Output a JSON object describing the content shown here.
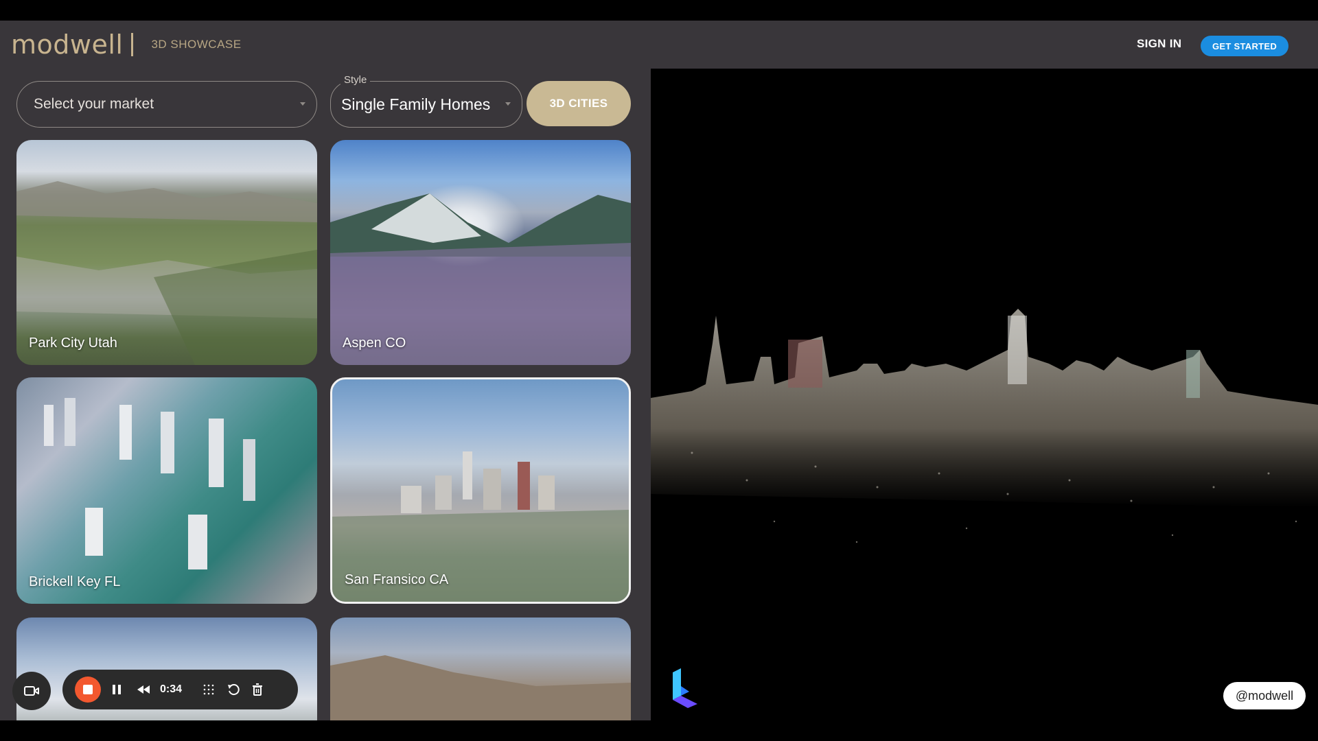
{
  "header": {
    "logo": "modwell",
    "subtitle": "3D SHOWCASE",
    "sign_in": "SIGN IN",
    "get_started": "GET STARTED"
  },
  "filters": {
    "market_placeholder": "Select your market",
    "style_label": "Style",
    "style_value": "Single Family Homes",
    "cities_button": "3D CITIES"
  },
  "cards": [
    {
      "label": "Park City Utah"
    },
    {
      "label": "Aspen CO"
    },
    {
      "label": "Brickell Key FL"
    },
    {
      "label": "San Fransico CA"
    },
    {
      "label": ""
    },
    {
      "label": ""
    }
  ],
  "recorder": {
    "timer": "0:34"
  },
  "watermark": "@modwell",
  "colors": {
    "header_bg": "#39363a",
    "accent_gold": "#c8b48f",
    "cta_blue": "#1b8de0",
    "record_red": "#f3582f"
  }
}
